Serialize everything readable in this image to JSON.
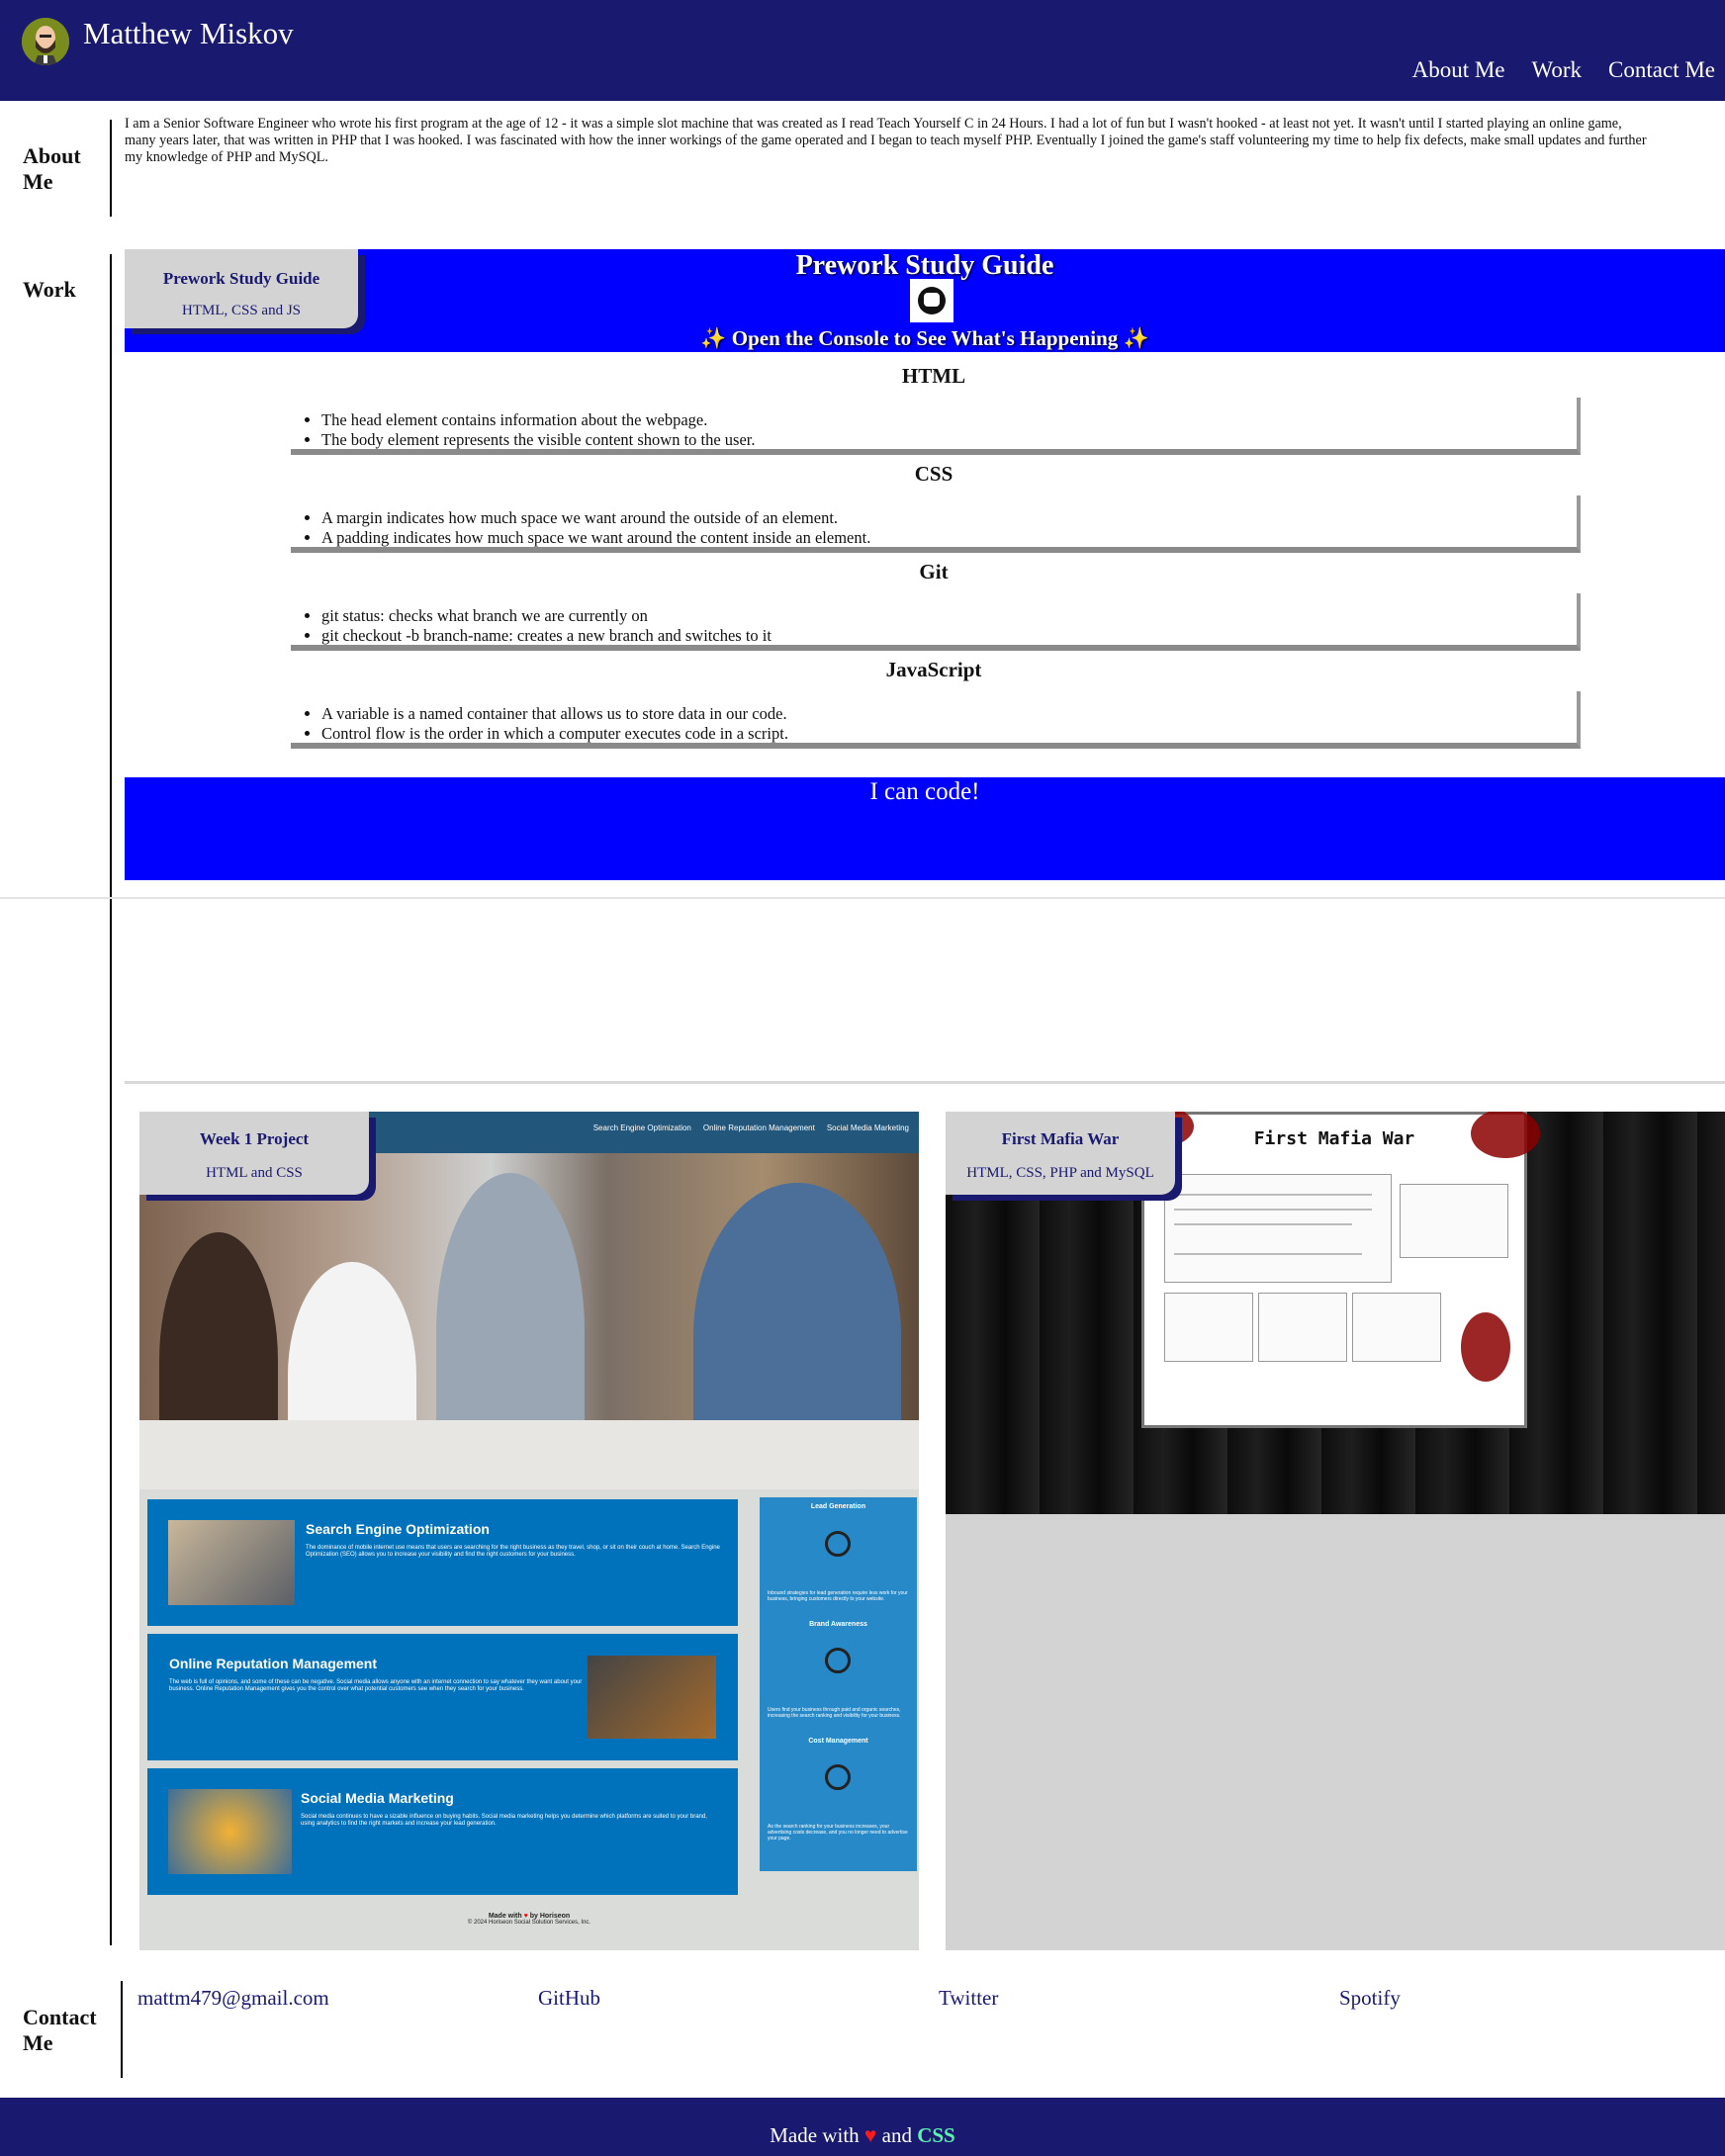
{
  "header": {
    "site_title": "Matthew Miskov",
    "nav": [
      "About Me",
      "Work",
      "Contact Me"
    ]
  },
  "about": {
    "label": "About Me",
    "text": "I am a Senior Software Engineer who wrote his first program at the age of 12 - it was a simple slot machine that was created as I read Teach Yourself C in 24 Hours. I had a lot of fun but I wasn't hooked - at least not yet. It wasn't until I started playing an online game,\nmany years later, that was written in PHP that I was hooked. I was fascinated with how the inner workings of the game operated and I began to teach myself PHP. Eventually I joined the game's staff volunteering my time to help fix defects, make small updates and further\nmy knowledge of PHP and MySQL."
  },
  "work": {
    "label": "Work",
    "prework": {
      "card_title": "Prework Study Guide",
      "card_tech": "HTML, CSS and JS",
      "title": "Prework Study Guide",
      "subtitle": "Open the Console to See What's Happening",
      "sections": [
        {
          "title": "HTML",
          "items": [
            "The head element contains information about the webpage.",
            "The body element represents the visible content shown to the user."
          ]
        },
        {
          "title": "CSS",
          "items": [
            "A margin indicates how much space we want around the outside of an element.",
            "A padding indicates how much space we want around the content inside an element."
          ]
        },
        {
          "title": "Git",
          "items": [
            "git status: checks what branch we are currently on",
            "git checkout -b branch-name: creates a new branch and switches to it"
          ]
        },
        {
          "title": "JavaScript",
          "items": [
            "A variable is a named container that allows us to store data in our code.",
            "Control flow is the order in which a computer executes code in a script."
          ]
        }
      ],
      "footer": "I can code!"
    },
    "week1": {
      "title": "Week 1 Project",
      "tech": "HTML and CSS",
      "menu": [
        "Search Engine Optimization",
        "Online Reputation Management",
        "Social Media Marketing"
      ],
      "boxes": [
        {
          "title": "Search Engine Optimization",
          "text": "The dominance of mobile internet use means that users are searching for the right business as they travel, shop, or sit on their couch at home. Search Engine Optimization (SEO) allows you to increase your visibility and find the right customers for your business."
        },
        {
          "title": "Online Reputation Management",
          "text": "The web is full of opinions, and some of these can be negative. Social media allows anyone with an internet connection to say whatever they want about your business. Online Reputation Management gives you the control over what potential customers see when they search for your business."
        },
        {
          "title": "Social Media Marketing",
          "text": "Social media continues to have a sizable influence on buying habits. Social media marketing helps you determine which platforms are suited to your brand, using analytics to find the right markets and increase your lead generation."
        }
      ],
      "sidebar": [
        {
          "title": "Lead Generation",
          "text": "Inbound strategies for lead generation require less work for your business, bringing customers directly to your website."
        },
        {
          "title": "Brand Awareness",
          "text": "Users find your business through paid and organic searches, increasing the search ranking and visibility for your business."
        },
        {
          "title": "Cost Management",
          "text": "As the search ranking for your business increases, your advertising costs decrease, and you no longer need to advertise your page."
        }
      ],
      "footer_made": "Made with",
      "footer_by": "by Horiseon",
      "footer_copy": "© 2024 Horiseon Social Solution Services, Inc."
    },
    "mafia": {
      "title": "First Mafia War",
      "tech": "HTML, CSS, PHP and MySQL",
      "page_title": "First Mafia War"
    }
  },
  "contact": {
    "label": "Contact Me",
    "links": [
      "mattm479@gmail.com",
      "GitHub",
      "Twitter",
      "Spotify"
    ]
  },
  "footer": {
    "made_with": "Made with",
    "and": "and",
    "css": "CSS"
  },
  "colors": {
    "navy": "#191970",
    "prework_blue": "#0000ff",
    "card_gray": "#d3d3d3"
  }
}
